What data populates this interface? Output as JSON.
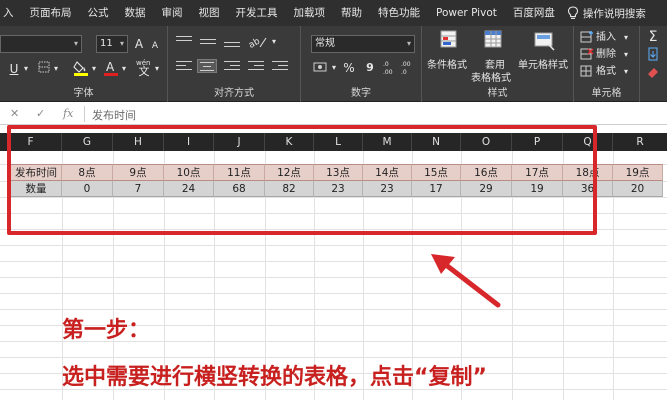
{
  "menu": {
    "items": [
      "入",
      "页面布局",
      "公式",
      "数据",
      "审阅",
      "视图",
      "开发工具",
      "加载项",
      "帮助",
      "特色功能",
      "Power Pivot",
      "百度网盘"
    ],
    "search": "操作说明搜索"
  },
  "ribbon": {
    "font": {
      "size": "11",
      "grow": "A",
      "shrink": "A",
      "underline": "U",
      "label": "字体",
      "wen": "wén",
      "wen_char": "文"
    },
    "alignment": {
      "label": "对齐方式"
    },
    "number": {
      "format": "常规",
      "percent": "%",
      "comma": "9",
      "label": "数字"
    },
    "styles": {
      "conditional": "条件格式",
      "table_line1": "套用",
      "table_line2": "表格格式",
      "cell_styles": "单元格样式",
      "label": "样式"
    },
    "cells": {
      "insert": "插入",
      "delete": "删除",
      "format": "格式",
      "label": "单元格"
    }
  },
  "formula_bar": {
    "cancel": "✕",
    "confirm": "✓",
    "fx": "fx",
    "content": "发布时间"
  },
  "columns": [
    "F",
    "G",
    "H",
    "I",
    "J",
    "K",
    "L",
    "M",
    "N",
    "O",
    "P",
    "Q",
    "R"
  ],
  "table": {
    "row1": [
      "发布时间",
      "8点",
      "9点",
      "10点",
      "11点",
      "12点",
      "13点",
      "14点",
      "15点",
      "16点",
      "17点",
      "18点",
      "19点"
    ],
    "row2": [
      "数量",
      "0",
      "7",
      "24",
      "68",
      "82",
      "23",
      "23",
      "17",
      "29",
      "19",
      "36",
      "20"
    ]
  },
  "instructions": {
    "line1": "第一步：",
    "line2": "选中需要进行横竖转换的表格，点击“复制”"
  },
  "colors": {
    "accent_red": "#d8272b",
    "header_fill": "#e7cfc9",
    "row_fill": "#d4d4d4",
    "ribbon_bg": "#3a3a3a"
  }
}
